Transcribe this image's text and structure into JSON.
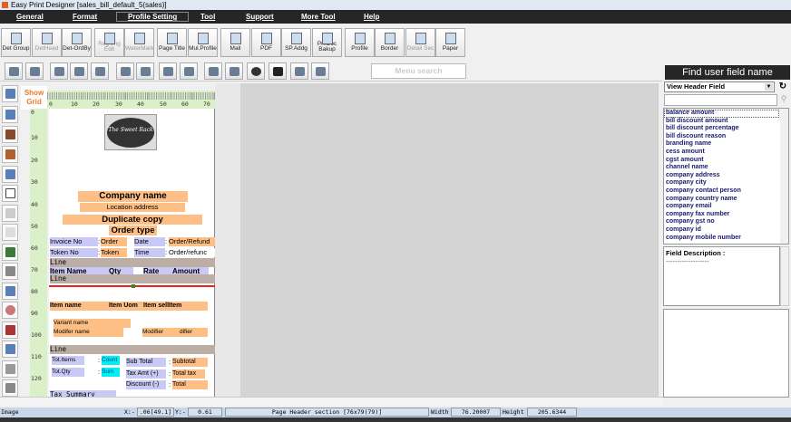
{
  "title": "Easy Print Designer [sales_bill_default_5(sales)]",
  "menu": [
    "General",
    "Format",
    "Profile Setting",
    "Tool",
    "Support",
    "More Tool",
    "Help"
  ],
  "toolbar1": [
    "Det Group",
    "DetHead",
    "Det-OrdBy",
    "Reg Lng Edit",
    "WaterMark",
    "Page Title",
    "Mul.Profile",
    "Mail",
    "PDF",
    "SP.Addg",
    "Pri.Doc Bakup",
    "Profile",
    "Border",
    "Detail Sec",
    "Paper"
  ],
  "menu_search_placeholder": "Menu search",
  "show_grid": "Show Grid",
  "ruler_h": [
    "0",
    "10",
    "20",
    "30",
    "40",
    "50",
    "60",
    "70"
  ],
  "ruler_v": [
    "0",
    "10",
    "20",
    "30",
    "40",
    "50",
    "60",
    "70",
    "80",
    "90",
    "100",
    "110",
    "120"
  ],
  "logo_text": "The Sweet Rack",
  "fields": {
    "company_name": "Company name",
    "location": "Location address",
    "duplicate": "Duplicate copy",
    "order_type": "Order type",
    "invoice_no": "Invoice No",
    "colon": ":",
    "order": "Order",
    "date": "Date",
    "order_refund": "Order/Refund",
    "token_no": "Token No",
    "token": "Token",
    "time": "Time",
    "order_refund2": "Order/refunc",
    "line": "Line",
    "item_name_h": "Item Name",
    "qty_h": "Qty",
    "rate_h": "Rate",
    "amount_h": "Amount",
    "item_name": "Item name",
    "item_uom": "Item Uom",
    "item_sell": "Item sellItem",
    "variant_name": "Variant name",
    "modifier_name": "Modifer name",
    "modifier": "Modifier",
    "difier": "difier",
    "tot_items": "Tot.Items",
    "count": "Count",
    "sub_total": "Sub Total",
    "subtotal": "Subtotal",
    "tot_qty": "Tot.Qty",
    "sum": "Sum",
    "tax_amt": "Tax Amt  (+)",
    "total_tax": "Total tax",
    "discount": "Discount  (-)",
    "total": "Total",
    "tax_summary": "Tax Summary"
  },
  "right_panel": {
    "title": "Find user field name",
    "dropdown": "View Header Field",
    "list": [
      "balance amount",
      "bill discount amount",
      "bill discount percentage",
      "bill discount reason",
      "branding name",
      "cess amount",
      "cgst amount",
      "channel name",
      "company address",
      "company city",
      "company contact person",
      "company country name",
      "company email",
      "company fax number",
      "company gst no",
      "company id",
      "company mobile number"
    ],
    "desc_label": "Field Description :",
    "desc_value": "-------------------"
  },
  "status": {
    "type": "Image",
    "x_label": "X:-",
    "x_val": ".06[49.1]",
    "y_label": "Y:-",
    "y_val": "0.61",
    "section": "Page Header section [76x79(79)]",
    "width_label": "Width",
    "width_val": "76.20007",
    "height_label": "Height",
    "height_val": "205.6344"
  }
}
